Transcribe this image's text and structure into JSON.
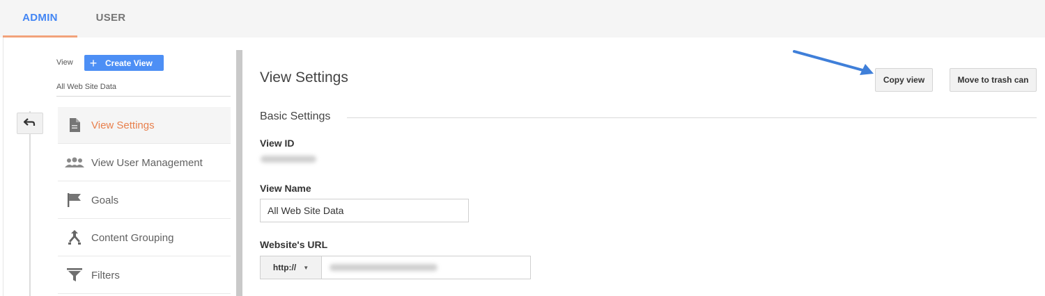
{
  "tabs": {
    "admin": "ADMIN",
    "user": "USER"
  },
  "left": {
    "view_label": "View",
    "create_view": "Create View",
    "current_view": "All Web Site Data",
    "nav": [
      {
        "label": "View Settings",
        "icon": "document-icon",
        "active": true
      },
      {
        "label": "View User Management",
        "icon": "people-icon"
      },
      {
        "label": "Goals",
        "icon": "flag-icon"
      },
      {
        "label": "Content Grouping",
        "icon": "content-grouping-icon"
      },
      {
        "label": "Filters",
        "icon": "filter-icon"
      }
    ]
  },
  "main": {
    "title": "View Settings",
    "copy_view": "Copy view",
    "move_to_trash": "Move to trash can",
    "section": "Basic Settings",
    "view_id_label": "View ID",
    "view_name_label": "View Name",
    "view_name_value": "All Web Site Data",
    "website_url_label": "Website's URL",
    "protocol": "http://"
  },
  "colors": {
    "accent_blue": "#4285f4",
    "active_orange": "#e8804d",
    "tab_underline": "#f2a27a",
    "arrow_blue": "#3f7fd9"
  }
}
